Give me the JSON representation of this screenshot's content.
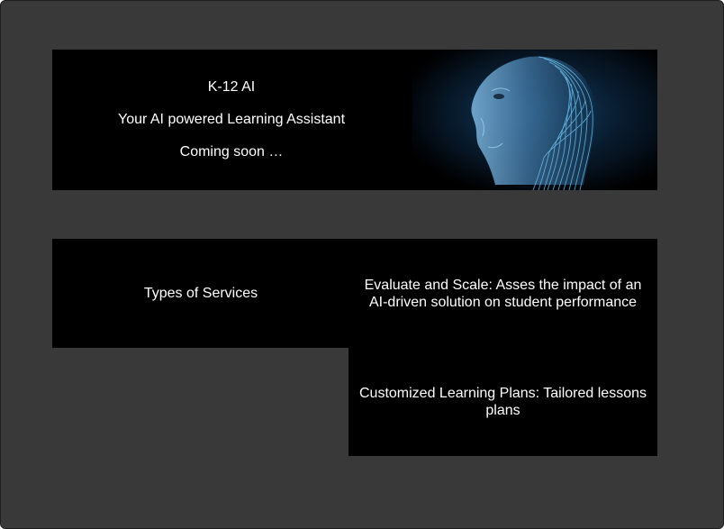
{
  "hero": {
    "title": "K-12 AI",
    "subtitle": "Your AI powered Learning Assistant",
    "status": "Coming soon …",
    "image_subject": "ai-head-wireframe"
  },
  "services": {
    "heading": "Types of Services",
    "items": [
      {
        "label": "Evaluate and Scale: Asses the impact of an AI-driven solution on student performance"
      },
      {
        "label": "Customized Learning Plans: Tailored lessons plans"
      }
    ]
  },
  "colors": {
    "background": "#393939",
    "panel": "#000000",
    "text": "#ffffff",
    "accent": "#3aa0d8"
  }
}
